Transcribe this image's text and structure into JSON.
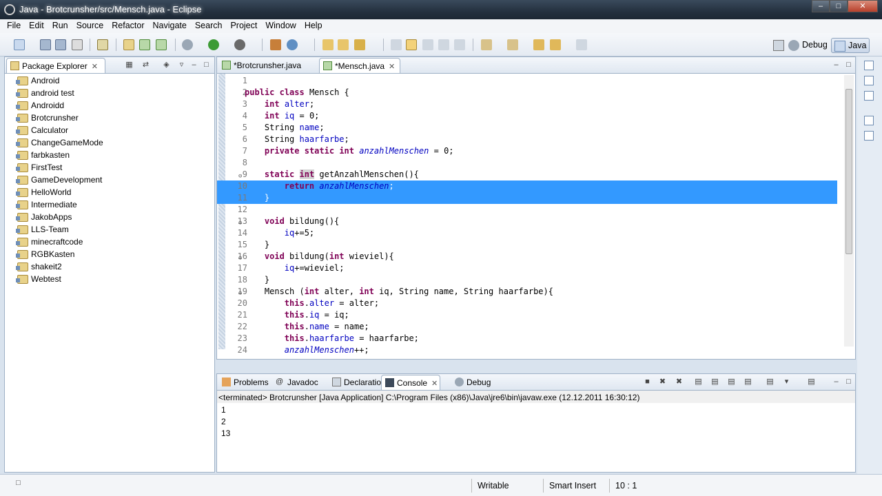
{
  "window": {
    "title": "Java - Brotcrunsher/src/Mensch.java - Eclipse"
  },
  "menubar": [
    "File",
    "Edit",
    "Run",
    "Source",
    "Refactor",
    "Navigate",
    "Search",
    "Project",
    "Window",
    "Help"
  ],
  "perspectives": {
    "debug_label": "Debug",
    "java_label": "Java"
  },
  "package_explorer": {
    "title": "Package Explorer",
    "projects": [
      "Android",
      "android test",
      "Androidd",
      "Brotcrunsher",
      "Calculator",
      "ChangeGameMode",
      "farbkasten",
      "FirstTest",
      "GameDevelopment",
      "HelloWorld",
      "Intermediate",
      "JakobApps",
      "LLS-Team",
      "minecraftcode",
      "RGBKasten",
      "shakeit2",
      "Webtest"
    ]
  },
  "editor": {
    "tabs": [
      "*Brotcrunsher.java",
      "*Mensch.java"
    ],
    "active_tab": "*Mensch.java",
    "selected_lines": [
      10,
      11
    ],
    "lines": [
      {
        "n": "1",
        "text": ""
      },
      {
        "n": "2",
        "text": "public class Mensch {"
      },
      {
        "n": "3",
        "text": "    int alter;"
      },
      {
        "n": "4",
        "text": "    int iq = 0;"
      },
      {
        "n": "5",
        "text": "    String name;"
      },
      {
        "n": "6",
        "text": "    String haarfarbe;"
      },
      {
        "n": "7",
        "text": "    private static int anzahlMenschen = 0;"
      },
      {
        "n": "8",
        "text": ""
      },
      {
        "n": "9",
        "text": "    static int getAnzahlMenschen(){"
      },
      {
        "n": "10",
        "text": "        return anzahlMenschen;"
      },
      {
        "n": "11",
        "text": "    }"
      },
      {
        "n": "12",
        "text": ""
      },
      {
        "n": "13",
        "text": "    void bildung(){"
      },
      {
        "n": "14",
        "text": "        iq+=5;"
      },
      {
        "n": "15",
        "text": "    }"
      },
      {
        "n": "16",
        "text": "    void bildung(int wieviel){"
      },
      {
        "n": "17",
        "text": "        iq+=wieviel;"
      },
      {
        "n": "18",
        "text": "    }"
      },
      {
        "n": "19",
        "text": "    Mensch (int alter, int iq, String name, String haarfarbe){"
      },
      {
        "n": "20",
        "text": "        this.alter = alter;"
      },
      {
        "n": "21",
        "text": "        this.iq = iq;"
      },
      {
        "n": "22",
        "text": "        this.name = name;"
      },
      {
        "n": "23",
        "text": "        this.haarfarbe = haarfarbe;"
      },
      {
        "n": "24",
        "text": "        anzahlMenschen++;"
      }
    ]
  },
  "bottom_panel": {
    "tabs": [
      "Problems",
      "Javadoc",
      "Declaration",
      "Console",
      "Debug"
    ],
    "active_tab": "Console",
    "console_header": "<terminated> Brotcrunsher [Java Application] C:\\Program Files (x86)\\Java\\jre6\\bin\\javaw.exe (12.12.2011 16:30:12)",
    "output": [
      "1",
      "2",
      "13"
    ]
  },
  "statusbar": {
    "writable": "Writable",
    "insert_mode": "Smart Insert",
    "position": "10 : 1"
  },
  "colors": {
    "keyword": "#7f0055",
    "field": "#0000c0",
    "selection": "#3399ff"
  }
}
